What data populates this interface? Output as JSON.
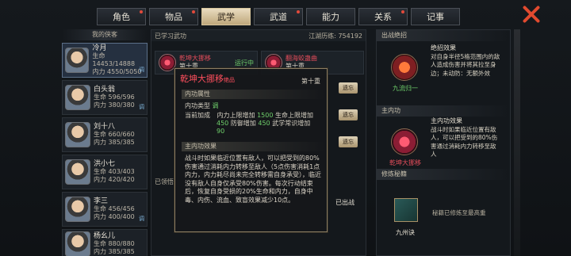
{
  "tabs": [
    {
      "label": "角色",
      "dot": true
    },
    {
      "label": "物品",
      "dot": true
    },
    {
      "label": "武学",
      "dot": false,
      "active": true
    },
    {
      "label": "武道",
      "dot": true
    },
    {
      "label": "能力",
      "dot": false
    },
    {
      "label": "关系",
      "dot": true
    },
    {
      "label": "记事",
      "dot": false
    }
  ],
  "heroes_title": "我的侠客",
  "heroes": [
    {
      "name": "冷月",
      "hp": "生命 14453/14888",
      "mp": "内力 4550/5050",
      "tag": "调"
    },
    {
      "name": "白头翁",
      "hp": "生命 596/596",
      "mp": "内力 380/380",
      "tag": "调"
    },
    {
      "name": "刘十八",
      "hp": "生命 660/660",
      "mp": "内力 385/385",
      "tag": ""
    },
    {
      "name": "洪小七",
      "hp": "生命 403/403",
      "mp": "内力 420/420",
      "tag": ""
    },
    {
      "name": "李三",
      "hp": "生命 456/456",
      "mp": "内力 400/400",
      "tag": "调"
    },
    {
      "name": "杨幺儿",
      "hp": "生命 880/880",
      "mp": "内力 385/385",
      "tag": ""
    }
  ],
  "mid": {
    "header_left": "已学习武功",
    "header_right": "江湖历练: 754192",
    "skill1": {
      "name": "乾坤大挪移",
      "level": "第十重",
      "status": "运行中",
      "tag": "内"
    },
    "skill2": {
      "name": "翻海蛟蛊曲",
      "level": "第十重"
    },
    "btn_label": "遗忘",
    "known_label": "已领悟",
    "battle_label": "已出战"
  },
  "tooltip": {
    "title": "乾坤大挪移",
    "title_suffix": "绝品",
    "level": "第十重",
    "sec1": "内功属性",
    "type_label": "内功类型",
    "type_value": "调",
    "bonus_label": "当前加成",
    "bonus_lines": [
      {
        "a": "内力上限增加",
        "v1": "1500",
        "b": "生命上限增加"
      },
      {
        "a": "",
        "v1": "450",
        "b": "防御增加"
      },
      {
        "a": "",
        "v1": "450",
        "b": "武学常识增加"
      },
      {
        "a": "",
        "v1": "90",
        "b": ""
      }
    ],
    "sec2": "主内功效果",
    "desc": "战斗时如果临近位置有敌人，可以把受到的80%伤害通过消耗内力转移至敌人（5点伤害消耗1点内力，内力耗尽尚未完全转移需自身承受），临近没有敌人自身仅承受80%伤害。每次行动结束后，恢复自身受损的20%生命和内力，自身中毒、内伤、流血、致盲效果减少10点。"
  },
  "right": {
    "sec1": "出战绝招",
    "sec2": "主内功",
    "sec3": "修炼秘籍",
    "ult_name": "九流归一",
    "ult_head": "绝招效果",
    "ult_text": "对自身半径5格范围内的敌人造成伤害并将其拉至身边；未动防：无额外效",
    "main_name": "乾坤大挪移",
    "main_head": "主内功效果",
    "main_text": "战斗时如果临近位置有敌人，可以把受到的80%伤害通过消耗内力转移至敌人",
    "book_name": "九州诀",
    "book_text": "秘籍已修炼至最高重"
  },
  "colors": {
    "accent": "#e24c5a",
    "positive": "#6fd06b",
    "tab_active": "#d6c49b"
  }
}
